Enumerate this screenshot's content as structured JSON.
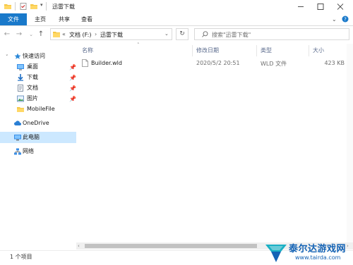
{
  "window": {
    "title": "迅雷下载"
  },
  "ribbon": {
    "tabs": [
      "文件",
      "主页",
      "共享",
      "查看"
    ]
  },
  "address": {
    "prefix": "«",
    "segments": [
      "文档 (F:)",
      "迅雷下载"
    ]
  },
  "search": {
    "placeholder": "搜索\"迅雷下载\""
  },
  "sidebar": {
    "items": [
      {
        "label": "快速访问",
        "icon": "star-icon"
      },
      {
        "label": "桌面",
        "icon": "desktop-icon",
        "pinned": true
      },
      {
        "label": "下载",
        "icon": "download-arrow-icon",
        "pinned": true
      },
      {
        "label": "文档",
        "icon": "document-icon",
        "pinned": true
      },
      {
        "label": "图片",
        "icon": "picture-icon",
        "pinned": true
      },
      {
        "label": "MobileFile",
        "icon": "folder-icon"
      },
      {
        "label": "OneDrive",
        "icon": "cloud-icon"
      },
      {
        "label": "此电脑",
        "icon": "computer-icon",
        "selected": true
      },
      {
        "label": "网络",
        "icon": "network-icon"
      }
    ]
  },
  "table": {
    "columns": [
      "名称",
      "修改日期",
      "类型",
      "大小"
    ],
    "rows": [
      {
        "name": "Builder.wld",
        "modified": "2020/5/2 20:51",
        "type": "WLD 文件",
        "size": "423 KB"
      }
    ]
  },
  "status": {
    "count": "1 个项目"
  },
  "watermark": {
    "line1": "泰尔达游戏网",
    "line2": "www.tairda.com"
  },
  "colors": {
    "accent": "#1979ca",
    "selected": "#cce8ff",
    "watermark_blue": "#1463b5",
    "watermark_teal": "#1ab0c4"
  }
}
